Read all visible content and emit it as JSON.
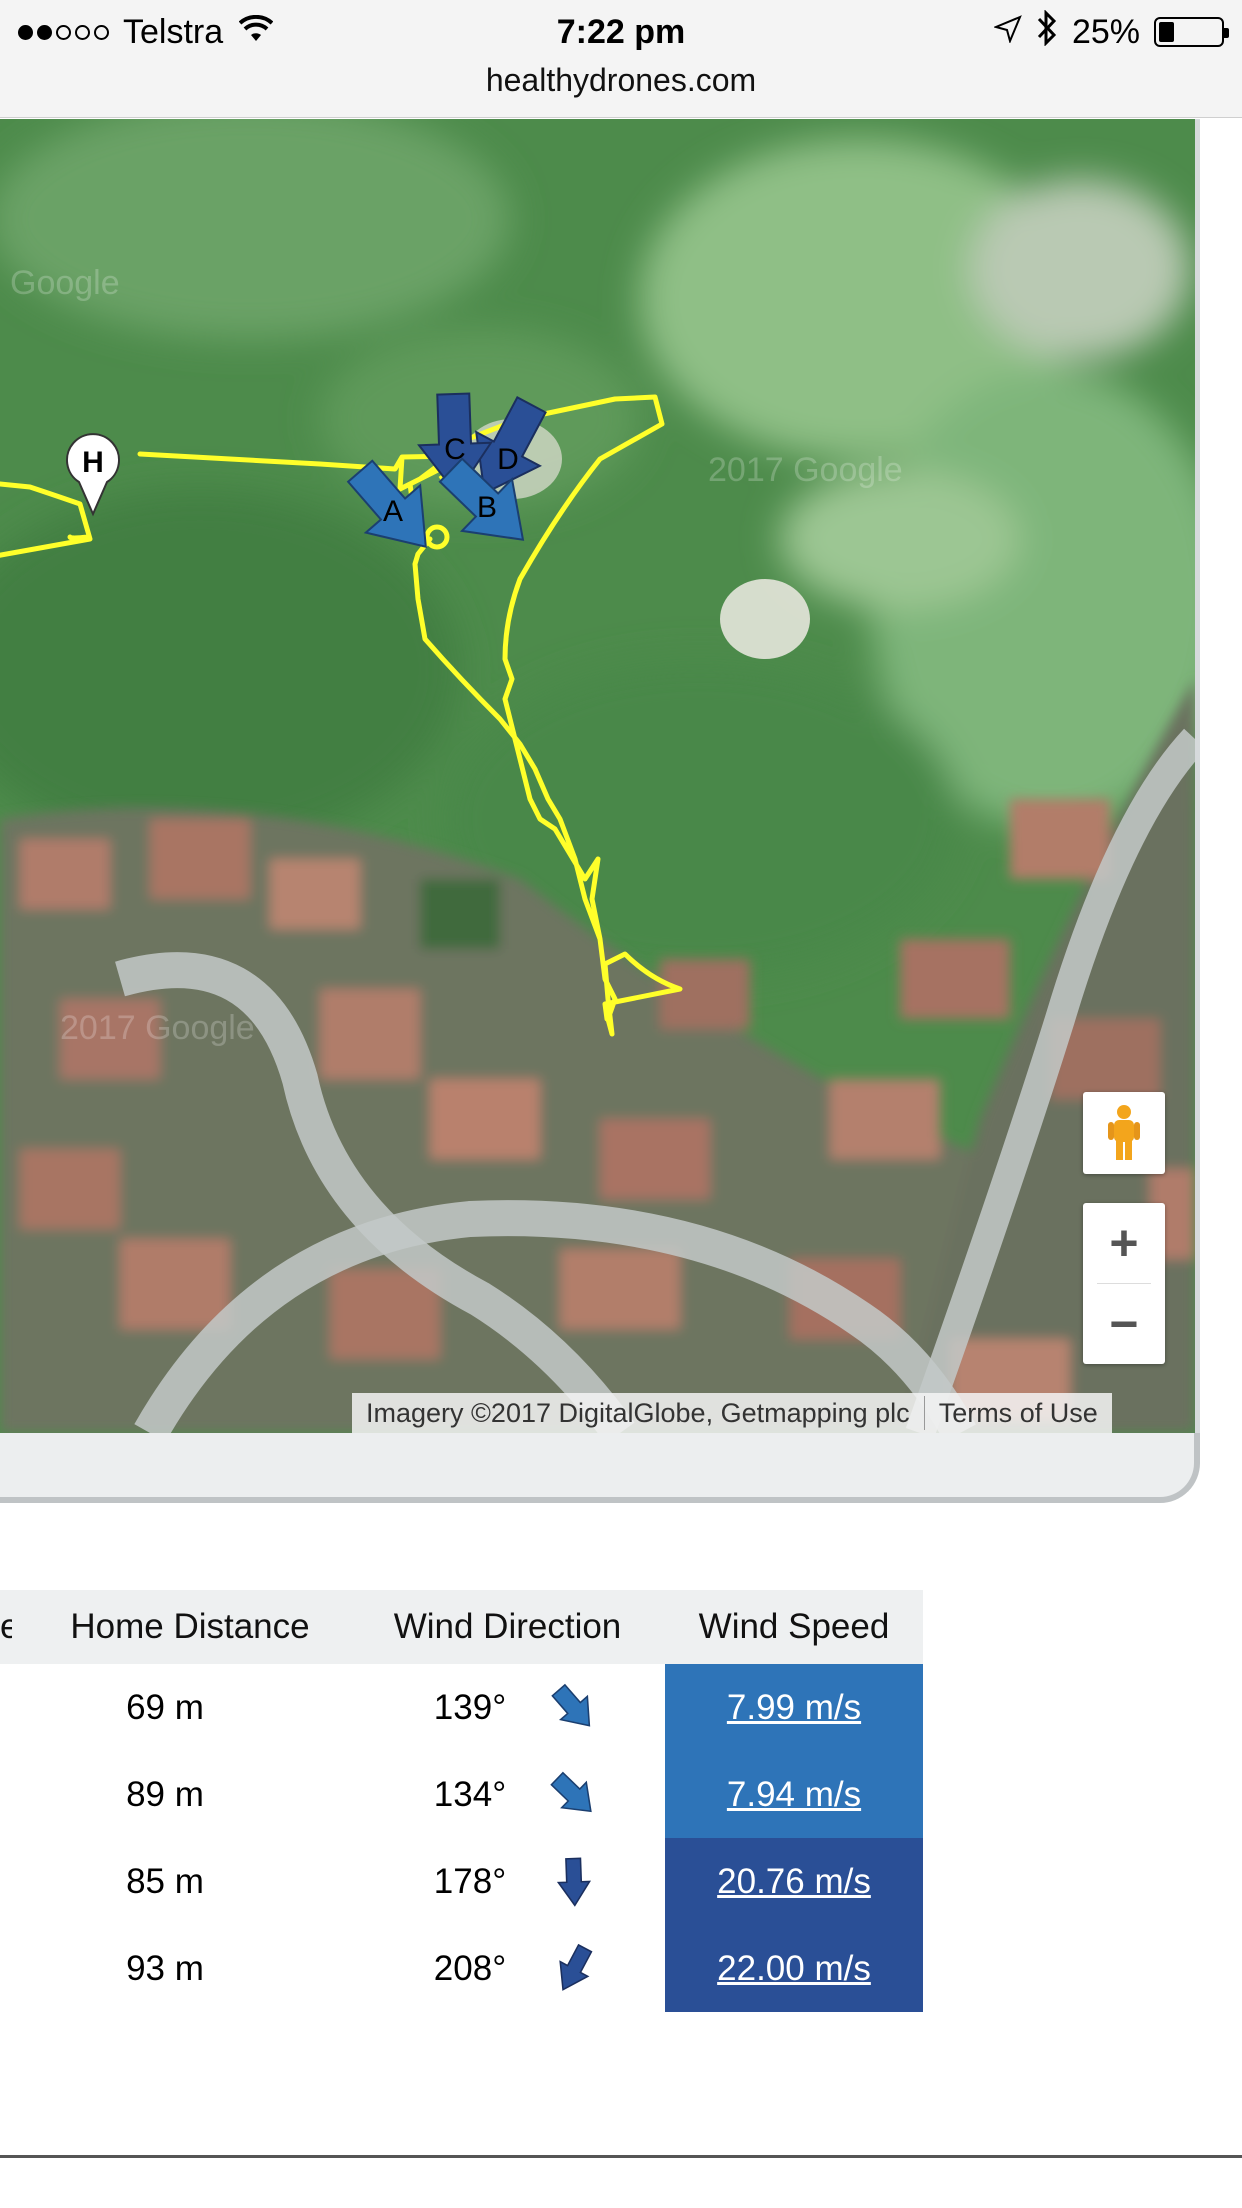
{
  "status_bar": {
    "signal_dots_full": 2,
    "signal_dots_total": 5,
    "carrier": "Telstra",
    "time": "7:22 pm",
    "battery_percent": "25%",
    "battery_level": 0.25
  },
  "browser": {
    "url": "healthydrones.com"
  },
  "map": {
    "home_marker_label": "H",
    "wind_markers": [
      "A",
      "B",
      "C",
      "D"
    ],
    "track_color": "#ffff00",
    "zoom_in_label": "+",
    "zoom_out_label": "−",
    "attribution": "Imagery ©2017 DigitalGlobe, Getmapping plc",
    "terms_label": "Terms of Use",
    "watermarks": [
      "Google",
      "2017 Google",
      "2017 Google"
    ]
  },
  "table": {
    "headers": [
      "Home Distance",
      "Wind Direction",
      "Wind Speed"
    ],
    "rows": [
      {
        "home_distance": "69 m",
        "wind_direction": "139°",
        "wind_speed": "7.99 m/s",
        "speed_level": "light"
      },
      {
        "home_distance": "89 m",
        "wind_direction": "134°",
        "wind_speed": "7.94 m/s",
        "speed_level": "light"
      },
      {
        "home_distance": "85 m",
        "wind_direction": "178°",
        "wind_speed": "20.76 m/s",
        "speed_level": "dark"
      },
      {
        "home_distance": "93 m",
        "wind_direction": "208°",
        "wind_speed": "22.00 m/s",
        "speed_level": "dark"
      }
    ]
  },
  "colors": {
    "speed_light": "#2e74b8",
    "speed_dark": "#2a4f96",
    "header_bg": "#eef0f1"
  }
}
